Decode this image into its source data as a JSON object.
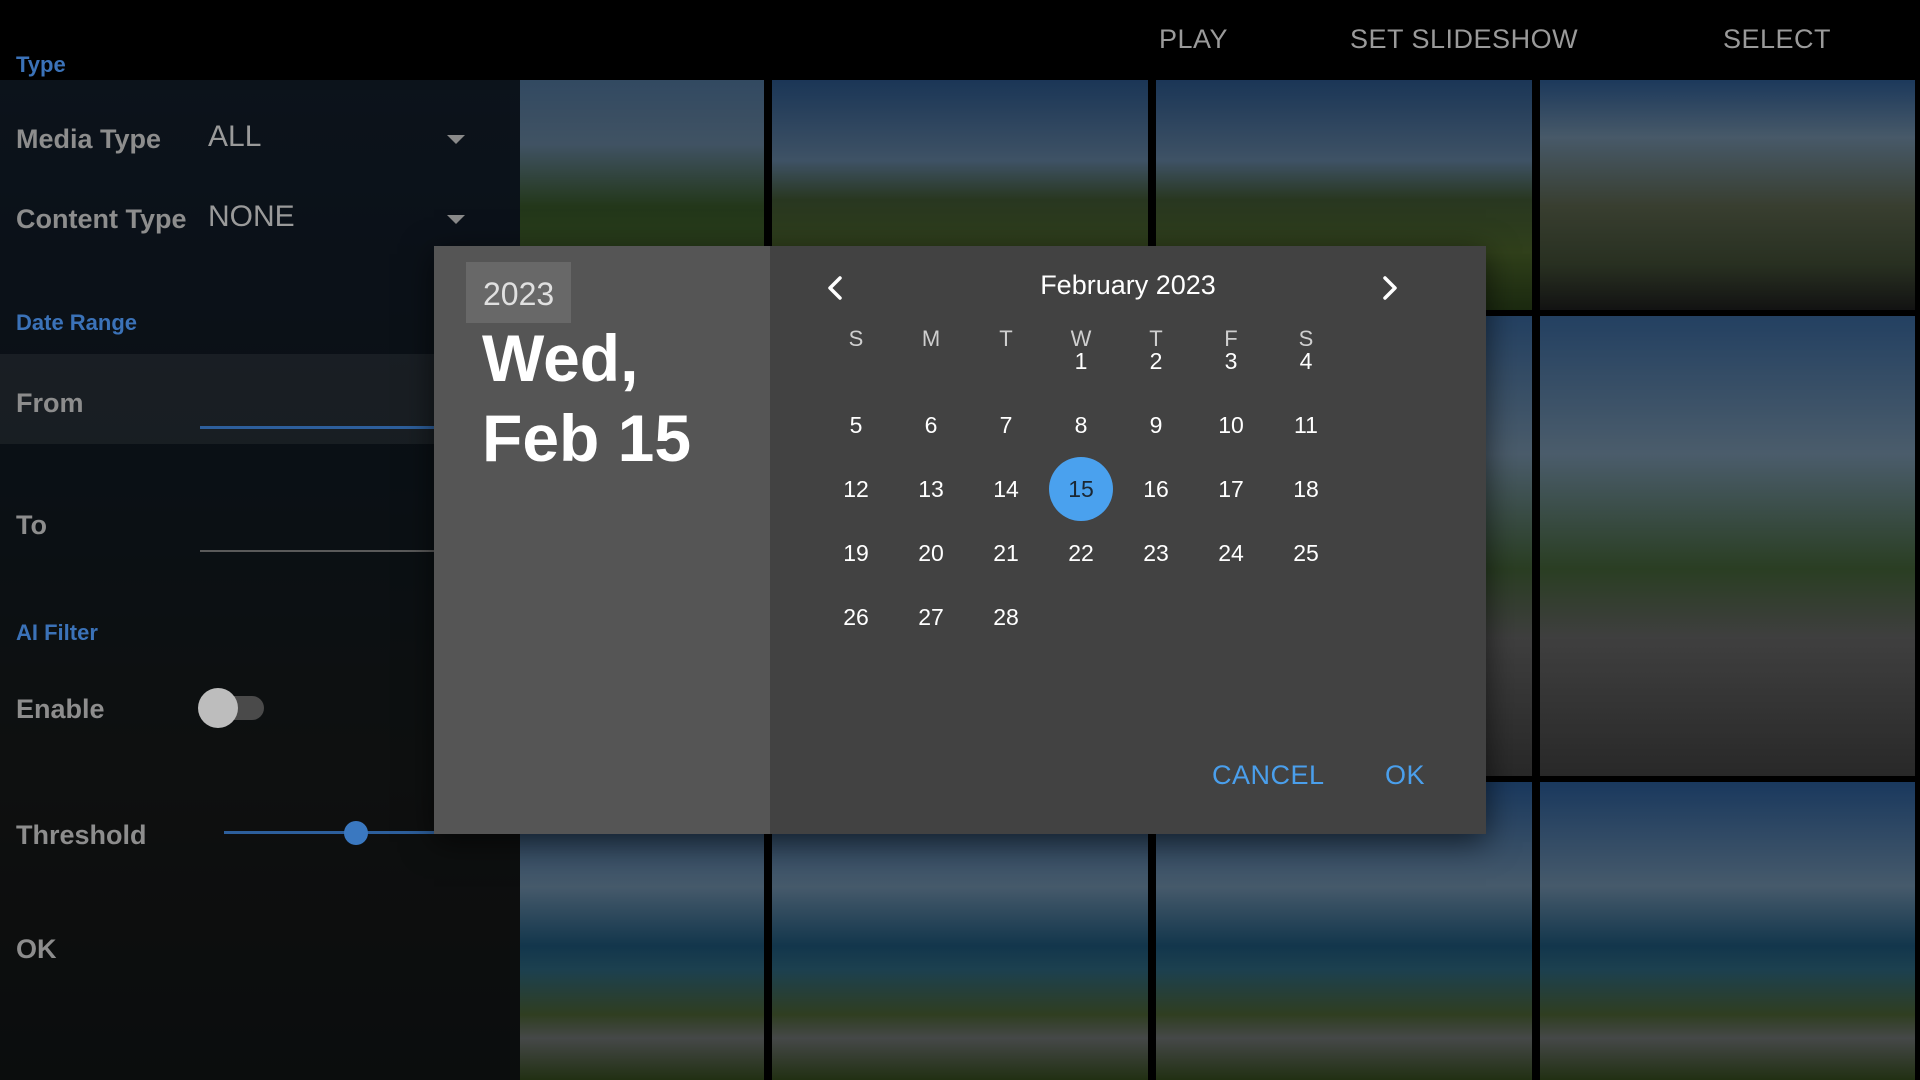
{
  "toolbar": {
    "play_label": "PLAY",
    "slideshow_label": "SET SLIDESHOW",
    "select_label": "SELECT"
  },
  "filter_panel": {
    "type_section": "Type",
    "media_type_label": "Media Type",
    "media_type_value": "ALL",
    "content_type_label": "Content Type",
    "content_type_value": "NONE",
    "date_range_section": "Date Range",
    "from_label": "From",
    "to_label": "To",
    "ai_filter_section": "AI Filter",
    "enable_label": "Enable",
    "enable_on": false,
    "threshold_label": "Threshold",
    "threshold_value": 0.52,
    "ok_label": "OK"
  },
  "date_picker": {
    "year": "2023",
    "selected_date": "Wed, Feb 15",
    "month_label": "February 2023",
    "weekday_headers": [
      "S",
      "M",
      "T",
      "W",
      "T",
      "F",
      "S"
    ],
    "days": [
      "1",
      "2",
      "3",
      "4",
      "5",
      "6",
      "7",
      "8",
      "9",
      "10",
      "11",
      "12",
      "13",
      "14",
      "15",
      "16",
      "17",
      "18",
      "19",
      "20",
      "21",
      "22",
      "23",
      "24",
      "25",
      "26",
      "27",
      "28"
    ],
    "selected_day": "15",
    "cancel_label": "CANCEL",
    "ok_label": "OK"
  },
  "colors": {
    "accent": "#4a9fec",
    "selected_day_bg": "#4aa1ee",
    "dialog_header_bg": "#555555",
    "dialog_body_bg": "#424242",
    "section_header": "#3b72b8"
  },
  "icons": {
    "prev_month": "chevron-left-icon",
    "next_month": "chevron-right-icon",
    "dropdown": "caret-down-icon"
  }
}
